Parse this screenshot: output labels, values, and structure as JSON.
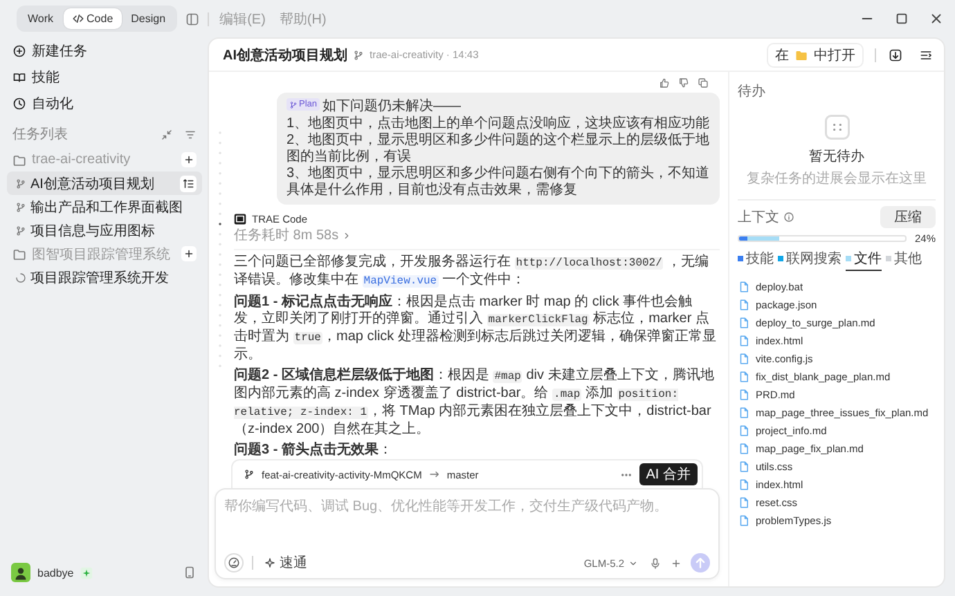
{
  "mode_switch": [
    {
      "label": "Work",
      "selected": false
    },
    {
      "label": "Code",
      "selected": true
    },
    {
      "label": "Design",
      "selected": false
    }
  ],
  "menus": [
    "编辑(E)",
    "帮助(H)"
  ],
  "sidebar": {
    "nav": [
      {
        "label": "新建任务"
      },
      {
        "label": "技能"
      },
      {
        "label": "自动化"
      }
    ],
    "section_title": "任务列表",
    "projects": [
      {
        "name": "trae-ai-creativity",
        "children": [
          {
            "label": "AI创意活动项目规划",
            "selected": true,
            "kind": "branch"
          },
          {
            "label": "输出产品和工作界面截图",
            "selected": false,
            "kind": "branch"
          },
          {
            "label": "项目信息与应用图标",
            "selected": false,
            "kind": "branch"
          }
        ]
      },
      {
        "name": "图智项目跟踪管理系统",
        "children": [
          {
            "label": "项目跟踪管理系统开发",
            "selected": false,
            "kind": "running"
          }
        ]
      }
    ],
    "user": {
      "name": "badbye"
    }
  },
  "header": {
    "title": "AI创意活动项目规划",
    "subtitle": "trae-ai-creativity · 14:43",
    "open_prefix": "在",
    "open_suffix": "中打开"
  },
  "user_message": {
    "tag": "Plan",
    "lines": [
      "如下问题仍未解决——",
      "1、地图页中，点击地图上的单个问题点没响应，这块应该有相应功能",
      "2、地图页中，显示思明区和多少件问题的这个栏显示上的层级低于地图的当前比例，有误",
      "3、地图页中，显示思明区和多少件问题右侧有个向下的箭头，不知道具体是什么作用，目前也没有点击效果，需修复"
    ]
  },
  "reply": {
    "author": "TRAE Code",
    "duration": "任务耗时 8m 58s",
    "paragraphs": [
      [
        {
          "kind": "text",
          "text": "三个问题已全部修复完成，开发服务器运行在 "
        },
        {
          "kind": "code",
          "text": "http://localhost:3002/"
        },
        {
          "kind": "text",
          "text": " ，无编译错误。修改集中在 "
        },
        {
          "kind": "link",
          "text": "MapView.vue"
        },
        {
          "kind": "text",
          "text": " 一个文件中："
        }
      ],
      [
        {
          "kind": "bold",
          "text": "问题1 - 标记点点击无响应"
        },
        {
          "kind": "text",
          "text": "：根因是点击 marker 时 map 的 click 事件也会触发，立即关闭了刚打开的弹窗。通过引入 "
        },
        {
          "kind": "code",
          "text": "markerClickFlag"
        },
        {
          "kind": "text",
          "text": " 标志位，marker 点击时置为 "
        },
        {
          "kind": "code",
          "text": "true"
        },
        {
          "kind": "text",
          "text": "，map click 处理器检测到标志后跳过关闭逻辑，确保弹窗正常显示。"
        }
      ],
      [
        {
          "kind": "bold",
          "text": "问题2 - 区域信息栏层级低于地图"
        },
        {
          "kind": "text",
          "text": "：根因是 "
        },
        {
          "kind": "code",
          "text": "#map"
        },
        {
          "kind": "text",
          "text": " div 未建立层叠上下文，腾讯地图内部元素的高 z-index 穿透覆盖了 district-bar。给 "
        },
        {
          "kind": "code",
          "text": ".map"
        },
        {
          "kind": "text",
          "text": " 添加 "
        },
        {
          "kind": "code",
          "text": "position: relative; z-index: 1"
        },
        {
          "kind": "text",
          "text": "，将 TMap 内部元素困在独立层叠上下文中，district-bar（z-index 200）自然在其之上。"
        }
      ],
      [
        {
          "kind": "bold",
          "text": "问题3 - 箭头点击无效果"
        },
        {
          "kind": "text",
          "text": "："
        }
      ]
    ]
  },
  "branch_bar": {
    "source": "feat-ai-creativity-activity-MmQKCM",
    "target": "master",
    "merge_button": "AI 合并"
  },
  "composer": {
    "placeholder": "帮你编写代码、调试 Bug、优化性能等开发工作，交付生产级代码产物。",
    "mode": "速通",
    "model": "GLM-5.2"
  },
  "todo": {
    "title": "待办",
    "empty_title": "暂无待办",
    "empty_hint": "复杂任务的进展会显示在这里"
  },
  "context": {
    "title": "上下文",
    "compress_button": "压缩",
    "percent": "24%",
    "segments": [
      {
        "color": "#3b7ff0",
        "level": 0.05
      },
      {
        "color": "#a6ddf6",
        "level": 0.19
      }
    ],
    "legend": [
      {
        "label": "技能",
        "color": "#3b7ff0",
        "selected": false
      },
      {
        "label": "联网搜索",
        "color": "#11a7e8",
        "selected": false
      },
      {
        "label": "文件",
        "color": "#a6ddf6",
        "selected": true
      },
      {
        "label": "其他",
        "color": "#d3d6da",
        "selected": false
      }
    ],
    "files": [
      "deploy.bat",
      "package.json",
      "deploy_to_surge_plan.md",
      "index.html",
      "vite.config.js",
      "fix_dist_blank_page_plan.md",
      "PRD.md",
      "map_page_three_issues_fix_plan.md",
      "project_info.md",
      "map_page_fix_plan.md",
      "utils.css",
      "index.html",
      "reset.css",
      "problemTypes.js"
    ]
  }
}
